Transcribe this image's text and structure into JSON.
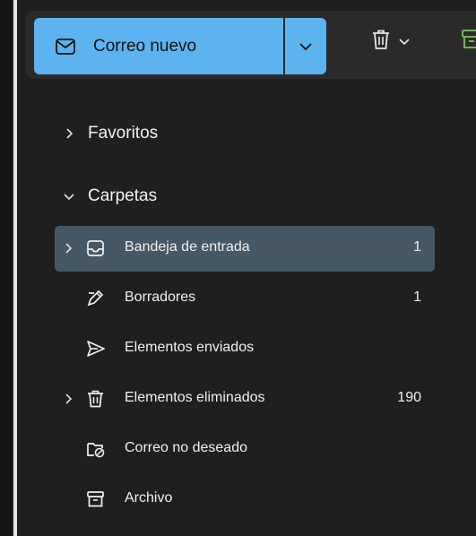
{
  "toolbar": {
    "new_mail_label": "Correo nuevo",
    "accent": "#5cb3f0"
  },
  "nav": {
    "favorites_label": "Favoritos",
    "folders_label": "Carpetas"
  },
  "folders": [
    {
      "label": "Bandeja de entrada",
      "count": "1",
      "icon": "inbox-icon",
      "selected": true
    },
    {
      "label": "Borradores",
      "count": "1",
      "icon": "drafts-icon"
    },
    {
      "label": "Elementos enviados",
      "count": "",
      "icon": "send-icon"
    },
    {
      "label": "Elementos eliminados",
      "count": "190",
      "icon": "trash-icon"
    },
    {
      "label": "Correo no deseado",
      "count": "",
      "icon": "junk-icon"
    },
    {
      "label": "Archivo",
      "count": "",
      "icon": "archive-icon"
    }
  ],
  "colors": {
    "background": "#1f1f1f",
    "selected_row": "#465866",
    "text": "#f0f0f0"
  }
}
